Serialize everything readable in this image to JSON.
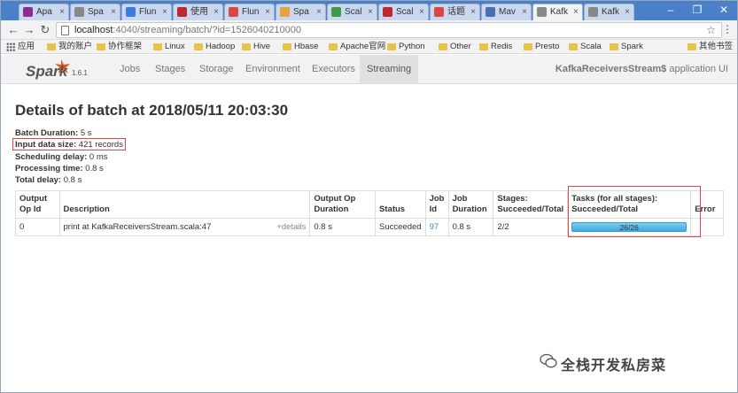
{
  "browser": {
    "tabs": [
      {
        "label": "Apa",
        "icon": "feather-icon",
        "color": "#8a2d8f"
      },
      {
        "label": "Spa",
        "icon": "page-icon",
        "color": "#888888"
      },
      {
        "label": "Flun",
        "icon": "paw-icon",
        "color": "#3b7ddd"
      },
      {
        "label": "使用",
        "icon": "c-icon",
        "color": "#c0272d"
      },
      {
        "label": "Flun",
        "icon": "feather-icon",
        "color": "#d44"
      },
      {
        "label": "Spa",
        "icon": "star-icon",
        "color": "#e8a23a"
      },
      {
        "label": "Scal",
        "icon": "table-icon",
        "color": "#3f9a4a"
      },
      {
        "label": "Scal",
        "icon": "stack-icon",
        "color": "#c0272d"
      },
      {
        "label": "话题",
        "icon": "feather-icon",
        "color": "#d44"
      },
      {
        "label": "Mav",
        "icon": "mvn-icon",
        "color": "#4a6fb0"
      },
      {
        "label": "Kafk",
        "icon": "page-icon",
        "color": "#888888"
      },
      {
        "label": "Kafk",
        "icon": "page-icon",
        "color": "#888888"
      }
    ],
    "active_tab": 10,
    "url_host": "localhost",
    "url_rest": ":4040/streaming/batch/?id=1526040210000",
    "bookmarks": [
      "应用",
      "我的账户",
      "协作框架",
      "Linux",
      "Hadoop",
      "Hive",
      "Hbase",
      "Apache官网",
      "Python",
      "Other",
      "Redis",
      "Presto",
      "Scala",
      "Spark",
      "其他书签"
    ]
  },
  "spark": {
    "version": "1.6.1",
    "nav": [
      "Jobs",
      "Stages",
      "Storage",
      "Environment",
      "Executors",
      "Streaming"
    ],
    "active_nav": "Streaming",
    "app_name": "KafkaReceiversStream$",
    "app_suffix": " application UI"
  },
  "page": {
    "title": "Details of batch at 2018/05/11 20:03:30",
    "info": [
      {
        "label": "Batch Duration:",
        "value": " 5 s"
      },
      {
        "label": "Input data size:",
        "value": " 421 records"
      },
      {
        "label": "Scheduling delay:",
        "value": " 0 ms"
      },
      {
        "label": "Processing time:",
        "value": " 0.8 s"
      },
      {
        "label": "Total delay:",
        "value": " 0.8 s"
      }
    ]
  },
  "table": {
    "headers": {
      "op_id": [
        "Output",
        "Op Id"
      ],
      "description": "Description",
      "op_duration": [
        "Output Op",
        "Duration"
      ],
      "status": "Status",
      "job_id": [
        "Job",
        "Id"
      ],
      "job_duration": [
        "Job",
        "Duration"
      ],
      "stages": [
        "Stages:",
        "Succeeded/Total"
      ],
      "tasks": [
        "Tasks (for all stages):",
        "Succeeded/Total"
      ],
      "error": "Error"
    },
    "row": {
      "op_id": "0",
      "description": "print at KafkaReceiversStream.scala:47",
      "details": "+details",
      "op_duration": "0.8 s",
      "status": "Succeeded",
      "job_id": "97",
      "job_duration": "0.8 s",
      "stages": "2/2",
      "tasks": "26/26",
      "tasks_fraction": 1.0,
      "error": ""
    }
  },
  "watermark": "全栈开发私房菜",
  "colors": {
    "accent": "#3a86c4",
    "highlight": "#d9484f",
    "progress": "#4eb7e8"
  }
}
